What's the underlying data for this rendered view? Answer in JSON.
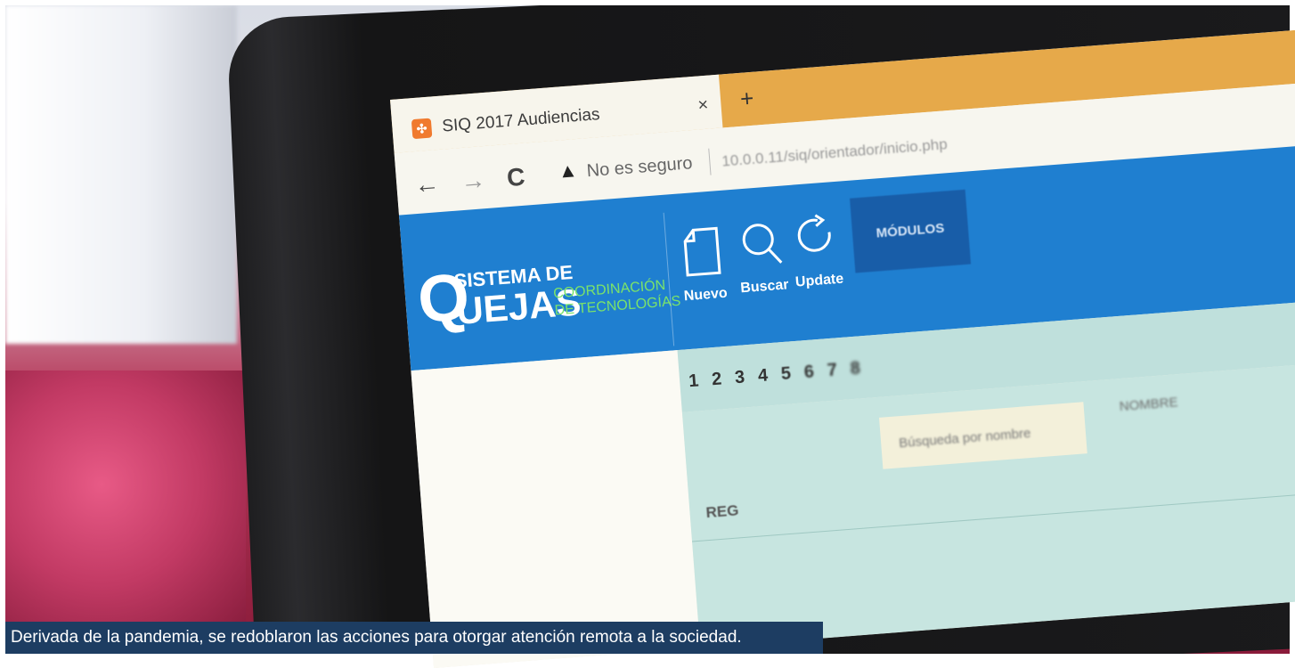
{
  "browser": {
    "tab_title": "SIQ 2017 Audiencias",
    "tab_close": "×",
    "new_tab": "+",
    "back": "←",
    "forward": "→",
    "reload": "C",
    "security_icon": "▲",
    "security_text": "No es seguro",
    "url": "10.0.0.11/siq/orientador/inicio.php"
  },
  "app": {
    "logo_q": "Q",
    "logo_line1": "SISTEMA DE",
    "logo_line2": "UEJAS",
    "logo_coord1": "COORDINACIÓN",
    "logo_coord2": "DE TECNOLOGÍAS",
    "tools": [
      {
        "label": "Nuevo",
        "icon": "document-icon"
      },
      {
        "label": "Buscar",
        "icon": "search-icon"
      },
      {
        "label": "Update",
        "icon": "refresh-icon"
      }
    ],
    "modules_label": "MÓDULOS",
    "pages": [
      "1",
      "2",
      "3",
      "4",
      "5",
      "6",
      "7",
      "8"
    ],
    "field_placeholder": "Búsqueda por nombre",
    "reg_label": "REG",
    "column_header": "NOMBRE"
  },
  "caption": "Derivada de la pandemia, se redoblaron las acciones para otorgar atención remota a la sociedad.",
  "colors": {
    "header_blue": "#1f7fd0",
    "accent_green": "#7be36a",
    "tab_orange": "#e6a94a",
    "caption_bg": "#1d3d62"
  }
}
